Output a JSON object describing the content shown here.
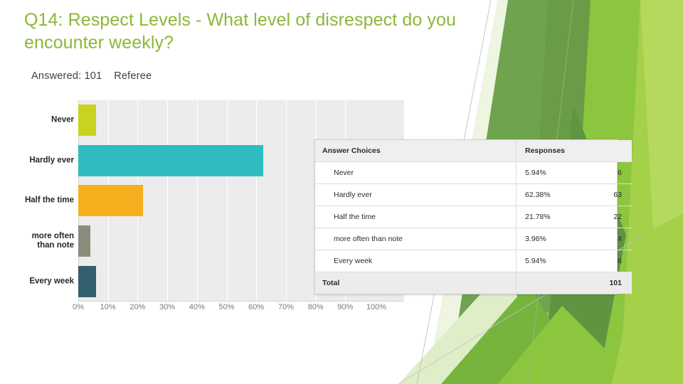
{
  "slide": {
    "title": "Q14: Respect Levels - What level of disrespect do you encounter weekly?",
    "subline": "Answered: 101    Referee",
    "answered_label": "Answered:",
    "answered_count": "101",
    "audience": "Referee",
    "title_color": "#8cb836"
  },
  "table": {
    "headers": [
      "Answer Choices",
      "Responses"
    ],
    "rows": [
      {
        "choice": "Never",
        "percent": "5.94%",
        "count": "6"
      },
      {
        "choice": "Hardly ever",
        "percent": "62.38%",
        "count": "63"
      },
      {
        "choice": "Half the time",
        "percent": "21.78%",
        "count": "22"
      },
      {
        "choice": "more often than note",
        "percent": "3.96%",
        "count": "4"
      },
      {
        "choice": "Every week",
        "percent": "5.94%",
        "count": "6"
      }
    ],
    "total_label": "Total",
    "total_value": "101"
  },
  "chart_data": {
    "type": "bar",
    "orientation": "horizontal",
    "title": "",
    "xlabel": "",
    "ylabel": "",
    "categories": [
      "Never",
      "Hardly ever",
      "Half the time",
      "more often than note",
      "Every week"
    ],
    "category_lines": [
      [
        "Never"
      ],
      [
        "Hardly ever"
      ],
      [
        "Half the time"
      ],
      [
        "more often",
        "than note"
      ],
      [
        "Every week"
      ]
    ],
    "values": [
      5.94,
      62.38,
      21.78,
      3.96,
      5.94
    ],
    "counts": [
      6,
      63,
      22,
      4,
      6
    ],
    "bar_colors": [
      "#c8d321",
      "#2fbcc0",
      "#f6af1e",
      "#8b8c7c",
      "#33606e"
    ],
    "xlim": [
      0,
      100
    ],
    "xticks": [
      0,
      10,
      20,
      30,
      40,
      50,
      60,
      70,
      80,
      90,
      100
    ],
    "xtick_labels": [
      "0%",
      "10%",
      "20%",
      "30%",
      "40%",
      "50%",
      "60%",
      "70%",
      "80%",
      "90%",
      "100%"
    ],
    "grid": true,
    "plot_background": "#ececec",
    "gridline_color": "#ffffff",
    "legend": "none",
    "total_responses": 101
  },
  "theme": {
    "name": "facet",
    "greens": [
      "#70a34f",
      "#6ea348",
      "#76b43e",
      "#8cc63e",
      "#a4d04a",
      "#b5d95c",
      "#e3f0cf",
      "#d6e9b9",
      "#5f9440"
    ]
  }
}
